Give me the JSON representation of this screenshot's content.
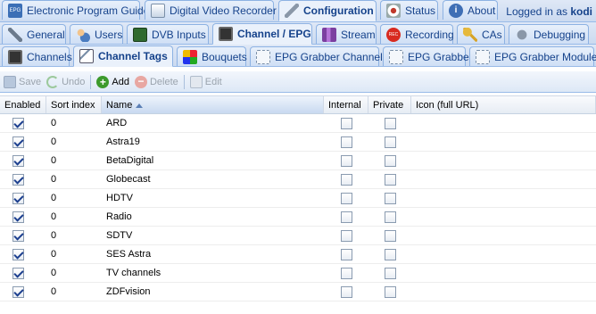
{
  "top_tabs": [
    {
      "label": "Electronic Program Guide",
      "icon": "epg-icon",
      "active": false
    },
    {
      "label": "Digital Video Recorder",
      "icon": "dvr-icon",
      "active": false
    },
    {
      "label": "Configuration",
      "icon": "wrench-icon",
      "active": true
    },
    {
      "label": "Status",
      "icon": "eye-icon",
      "active": false
    },
    {
      "label": "About",
      "icon": "info-icon",
      "active": false
    }
  ],
  "login": {
    "prefix": "Logged in as ",
    "user": "kodi"
  },
  "config_tabs": [
    {
      "label": "General",
      "icon": "tools-icon"
    },
    {
      "label": "Users",
      "icon": "users-icon"
    },
    {
      "label": "DVB Inputs",
      "icon": "tv-card-icon"
    },
    {
      "label": "Channel / EPG",
      "icon": "tv-icon"
    },
    {
      "label": "Stream",
      "icon": "stream-icon"
    },
    {
      "label": "Recording",
      "icon": "rec-icon"
    },
    {
      "label": "CAs",
      "icon": "key-icon"
    },
    {
      "label": "Debugging",
      "icon": "bug-icon"
    }
  ],
  "channel_tabs": [
    {
      "label": "Channels",
      "icon": "tv-icon"
    },
    {
      "label": "Channel Tags",
      "icon": "tags-icon"
    },
    {
      "label": "Bouquets",
      "icon": "bouquet-icon"
    },
    {
      "label": "EPG Grabber Channels",
      "icon": "grabber-icon"
    },
    {
      "label": "EPG Grabber",
      "icon": "grabber-icon"
    },
    {
      "label": "EPG Grabber Modules",
      "icon": "grabber-icon"
    }
  ],
  "toolbar": {
    "save": "Save",
    "undo": "Undo",
    "add": "Add",
    "delete": "Delete",
    "edit": "Edit"
  },
  "columns": {
    "enabled": "Enabled",
    "sort_index": "Sort index",
    "name": "Name",
    "internal": "Internal",
    "private": "Private",
    "icon": "Icon (full URL)"
  },
  "rows": [
    {
      "enabled": true,
      "sort": "0",
      "name": "ARD",
      "internal": false,
      "private": false
    },
    {
      "enabled": true,
      "sort": "0",
      "name": "Astra19",
      "internal": false,
      "private": false
    },
    {
      "enabled": true,
      "sort": "0",
      "name": "BetaDigital",
      "internal": false,
      "private": false
    },
    {
      "enabled": true,
      "sort": "0",
      "name": "Globecast",
      "internal": false,
      "private": false
    },
    {
      "enabled": true,
      "sort": "0",
      "name": "HDTV",
      "internal": false,
      "private": false
    },
    {
      "enabled": true,
      "sort": "0",
      "name": "Radio",
      "internal": false,
      "private": false
    },
    {
      "enabled": true,
      "sort": "0",
      "name": "SDTV",
      "internal": false,
      "private": false
    },
    {
      "enabled": true,
      "sort": "0",
      "name": "SES Astra",
      "internal": false,
      "private": false
    },
    {
      "enabled": true,
      "sort": "0",
      "name": "TV channels",
      "internal": false,
      "private": false
    },
    {
      "enabled": true,
      "sort": "0",
      "name": "ZDFvision",
      "internal": false,
      "private": false
    }
  ]
}
